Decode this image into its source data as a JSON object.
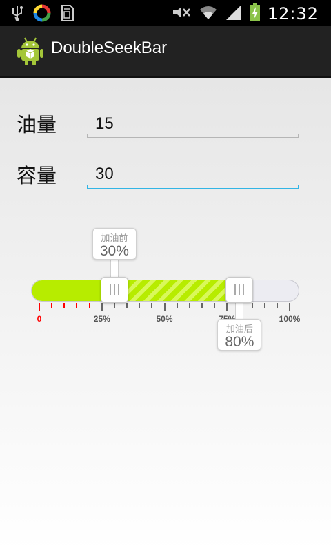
{
  "status_bar": {
    "time": "12:32",
    "left_icons": [
      "usb-icon",
      "sync-icon",
      "sd-card-icon"
    ],
    "right_icons": [
      "mute-icon",
      "wifi-icon",
      "signal-icon",
      "battery-charging-icon"
    ]
  },
  "action_bar": {
    "title": "DoubleSeekBar",
    "icon": "android-icon"
  },
  "form": {
    "oil": {
      "label": "油量",
      "value": "15"
    },
    "capacity": {
      "label": "容量",
      "value": "30"
    }
  },
  "seekbar": {
    "min": 0,
    "max": 100,
    "start_value": 30,
    "end_value": 80,
    "start_tip_label": "加油前",
    "start_tip_value": "30%",
    "end_tip_label": "加油后",
    "end_tip_value": "80%",
    "scale_labels": [
      {
        "text": "0",
        "value": 0
      },
      {
        "text": "25%",
        "value": 25
      },
      {
        "text": "50%",
        "value": 50
      },
      {
        "text": "75%",
        "value": 75
      },
      {
        "text": "100%",
        "value": 100
      }
    ],
    "warning_max": 20
  },
  "colors": {
    "accent_blue": "#33b5e5",
    "fill_green": "#b7ec00",
    "warning_red": "#ff0000",
    "scale_gray": "#555555"
  }
}
